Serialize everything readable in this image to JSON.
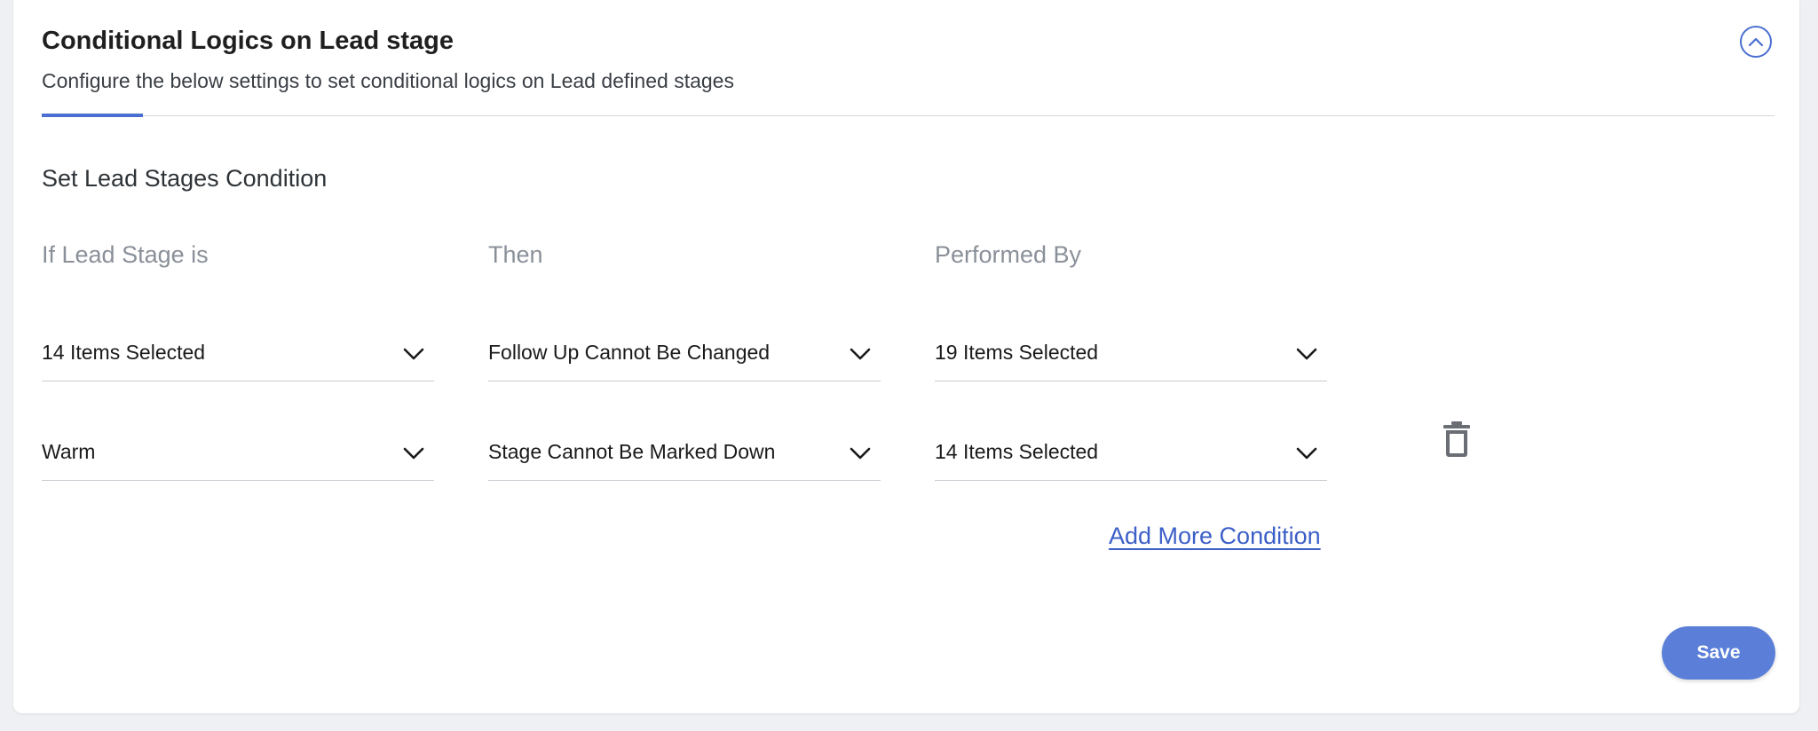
{
  "header": {
    "title": "Conditional Logics on Lead stage",
    "subtitle": "Configure the below settings to set conditional logics on Lead defined stages"
  },
  "section": {
    "title": "Set Lead Stages Condition",
    "columns": [
      "If Lead Stage is",
      "Then",
      "Performed By"
    ]
  },
  "rows": [
    {
      "lead_stage": "14 Items Selected",
      "then": "Follow Up Cannot Be Changed",
      "performed_by": "19 Items Selected"
    },
    {
      "lead_stage": "Warm",
      "then": "Stage Cannot Be Marked Down",
      "performed_by": "14 Items Selected"
    }
  ],
  "actions": {
    "add_more": "Add More Condition",
    "save": "Save"
  },
  "icons": {
    "collapse": "chevron-up-icon",
    "dropdown": "chevron-down-icon",
    "delete": "trash-icon"
  },
  "colors": {
    "accent": "#4a6fd1",
    "save_button": "#5b7fd8",
    "link": "#3b5fc7"
  }
}
